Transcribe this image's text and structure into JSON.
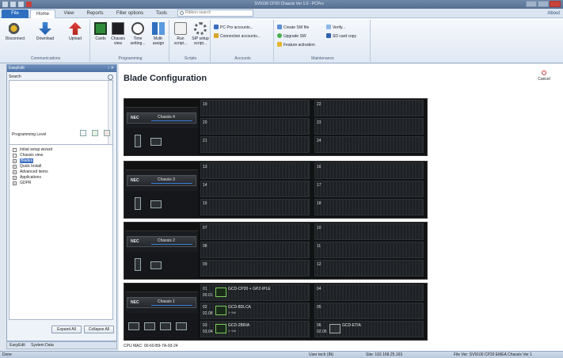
{
  "titlebar": {
    "title": "SV9100 CP20 Chassis Ver 1.0 - PCPro"
  },
  "tabs": [
    "File",
    "Home",
    "View",
    "Reports",
    "Filter options",
    "Tools"
  ],
  "ribbon_search": {
    "placeholder": "Ribbon search"
  },
  "help": {
    "about": "About"
  },
  "ribbon": {
    "communications": {
      "label": "Communications",
      "buttons": [
        "Disconnect",
        "Download",
        "Upload"
      ]
    },
    "programming": {
      "label": "Programming",
      "buttons": [
        "Cards",
        "Chassis view",
        "Time setting...",
        "Multi-assign"
      ]
    },
    "scripts": {
      "label": "Scripts",
      "buttons": [
        "Run script...",
        "SIP setup script..."
      ]
    },
    "accounts": {
      "label": "Accounts",
      "buttons": [
        "PC Pro accounts...",
        "Connection accounts..."
      ]
    },
    "maintenance": {
      "label": "Maintenance",
      "buttons": [
        "Create SW file",
        "Upgrade SW",
        "Feature activation",
        "Verify...",
        "SD card copy"
      ]
    }
  },
  "leftpane": {
    "title": "EasyEdit",
    "search_label": "Search",
    "programming_level_label": "Programming Level",
    "tree": [
      {
        "label": "Initial setup wizard",
        "box": ""
      },
      {
        "label": "Chassis view",
        "box": ""
      },
      {
        "label": "Blades",
        "box": "+",
        "selected": true
      },
      {
        "label": "Quick Install",
        "box": "+"
      },
      {
        "label": "Advanced items",
        "box": "+"
      },
      {
        "label": "Applications",
        "box": "+"
      },
      {
        "label": "GDPR",
        "box": "+"
      }
    ],
    "expand_all": "Expand All",
    "collapse_all": "Collapse All",
    "bottom_tabs": [
      "EasyEdit",
      "System Data"
    ]
  },
  "main": {
    "title": "Blade Configuration",
    "cancel": "Cancel",
    "cpu_mac": "CPU MAC: 00-60-B9-7A-93-24"
  },
  "chassis": [
    {
      "nec": "NEC",
      "name": "Chassis 4",
      "slots": [
        {
          "n": "19"
        },
        {
          "n": "22"
        },
        {
          "n": "20"
        },
        {
          "n": "23"
        },
        {
          "n": "21"
        },
        {
          "n": "24"
        }
      ]
    },
    {
      "nec": "NEC",
      "name": "Chassis 3",
      "slots": [
        {
          "n": "13"
        },
        {
          "n": "16"
        },
        {
          "n": "14"
        },
        {
          "n": "17"
        },
        {
          "n": "15"
        },
        {
          "n": "18"
        }
      ]
    },
    {
      "nec": "NEC",
      "name": "Chassis 2",
      "slots": [
        {
          "n": "07"
        },
        {
          "n": "10"
        },
        {
          "n": "08"
        },
        {
          "n": "11"
        },
        {
          "n": "09"
        },
        {
          "n": "12"
        }
      ]
    },
    {
      "nec": "NEC",
      "name": "Chassis 1",
      "slots": [
        {
          "n": "01",
          "sub": "00.01",
          "card": "GCD-CP20 + GPZ-IPLE",
          "csub": ""
        },
        {
          "n": "04"
        },
        {
          "n": "02",
          "sub": "02.08",
          "card": "GCD-8DLCA",
          "csub": "1~8äí"
        },
        {
          "n": "05"
        },
        {
          "n": "03",
          "sub": "03.04",
          "card": "GCD-2BRIA",
          "csub": "1~4äí"
        },
        {
          "n": "06",
          "sub": "02.05",
          "card": "GCD-ETIA",
          "csub": "",
          "gray": true
        }
      ]
    }
  ],
  "statusbar": {
    "left": "Done",
    "user": "User tech (IN)",
    "site": "Site: 192.168.25.163",
    "file_ver": "File Ver: SV9100 CP20 EMEA Chassis Ver 1"
  },
  "colors": {
    "file_tab": "#2f6fc0",
    "accent_blue": "#3b6cc2",
    "card_green": "#7ccf5c"
  }
}
